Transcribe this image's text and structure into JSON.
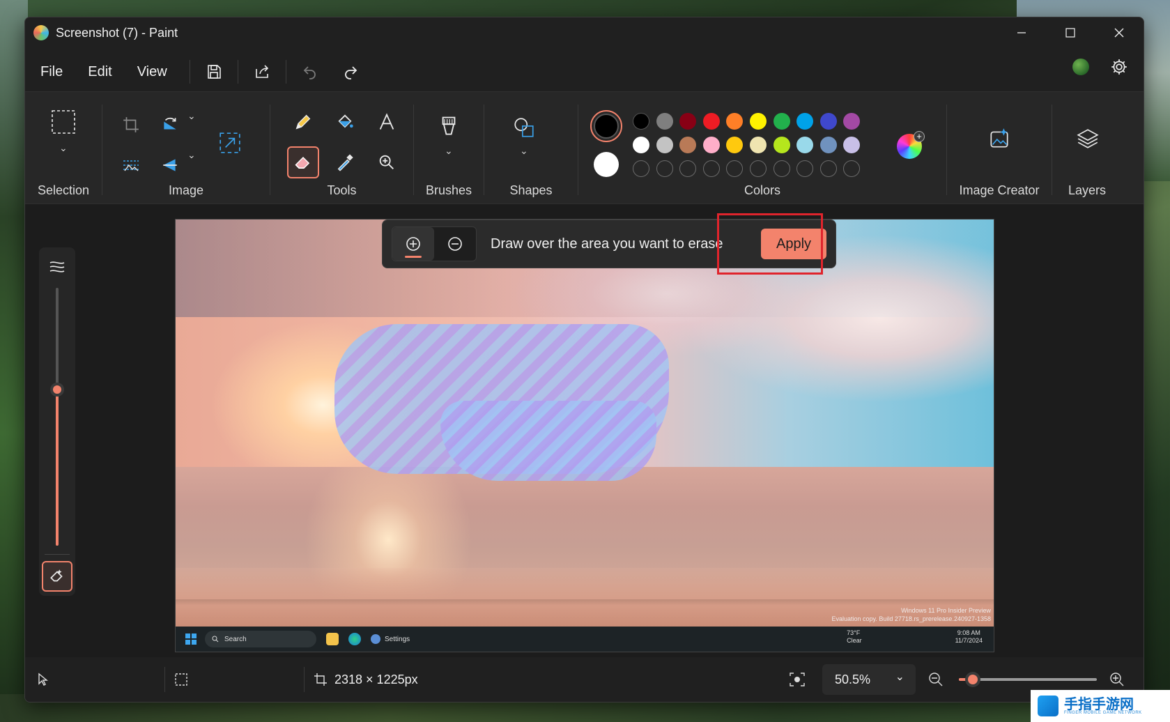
{
  "window": {
    "title": "Screenshot (7) - Paint"
  },
  "menu": {
    "file": "File",
    "edit": "Edit",
    "view": "View"
  },
  "ribbon": {
    "groups": {
      "selection": "Selection",
      "image": "Image",
      "tools": "Tools",
      "brushes": "Brushes",
      "shapes": "Shapes",
      "colors": "Colors",
      "image_creator": "Image Creator",
      "layers": "Layers"
    },
    "palette_row1": [
      "#000000",
      "#7f7f7f",
      "#880015",
      "#ed1c24",
      "#ff7f27",
      "#fff200",
      "#22b14c",
      "#00a2e8",
      "#3f48cc",
      "#a349a4"
    ],
    "palette_row2": [
      "#ffffff",
      "#c3c3c3",
      "#b97a57",
      "#ffaec9",
      "#ffc90e",
      "#efe4b0",
      "#b5e61d",
      "#99d9ea",
      "#7092be",
      "#c8bfe7"
    ],
    "primary_color": "#000000",
    "secondary_color": "#ffffff",
    "active_tool": "eraser-icon"
  },
  "erase_bar": {
    "hint": "Draw over the area you want to erase",
    "apply_label": "Apply",
    "active_mode": "add"
  },
  "canvas_image": {
    "watermark_line1": "Windows 11 Pro Insider Preview",
    "watermark_line2": "Evaluation copy. Build 27718.rs_prerelease.240927-1358",
    "taskbar": {
      "search_label": "Search",
      "settings_label": "Settings",
      "weather_temp": "73°F",
      "weather_desc": "Clear",
      "time": "9:08 AM",
      "date": "11/7/2024"
    }
  },
  "status": {
    "canvas_size": "2318 × 1225px",
    "zoom": "50.5%",
    "zoom_slider_fraction": 0.1
  },
  "accent_color": "#f3836c",
  "site_logo": {
    "text": "手指手游网",
    "sub": "FINGER MOBILE GAME NETWORK"
  }
}
